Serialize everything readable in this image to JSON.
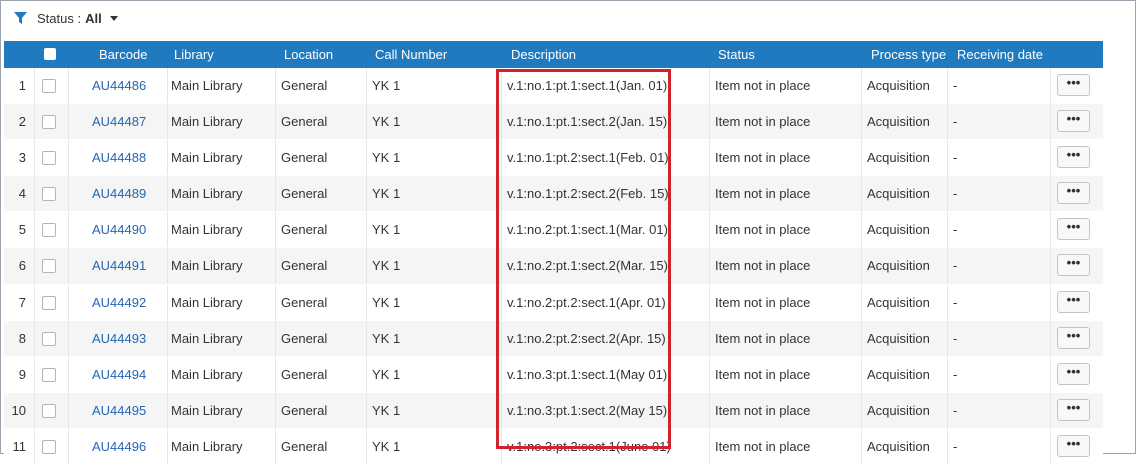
{
  "filter": {
    "status_label": "Status :",
    "status_value": "All"
  },
  "columns": {
    "barcode": "Barcode",
    "library": "Library",
    "location": "Location",
    "call_number": "Call Number",
    "description": "Description",
    "status": "Status",
    "process_type": "Process type",
    "receiving_date": "Receiving date"
  },
  "rows": [
    {
      "n": "1",
      "barcode": "AU44486",
      "library": "Main Library",
      "location": "General",
      "call": "YK 1",
      "description": "v.1:no.1:pt.1:sect.1(Jan. 01)",
      "status": "Item not in place",
      "process": "Acquisition",
      "received": "-",
      "more": "•••"
    },
    {
      "n": "2",
      "barcode": "AU44487",
      "library": "Main Library",
      "location": "General",
      "call": "YK 1",
      "description": "v.1:no.1:pt.1:sect.2(Jan. 15)",
      "status": "Item not in place",
      "process": "Acquisition",
      "received": "-",
      "more": "•••"
    },
    {
      "n": "3",
      "barcode": "AU44488",
      "library": "Main Library",
      "location": "General",
      "call": "YK 1",
      "description": "v.1:no.1:pt.2:sect.1(Feb. 01)",
      "status": "Item not in place",
      "process": "Acquisition",
      "received": "-",
      "more": "•••"
    },
    {
      "n": "4",
      "barcode": "AU44489",
      "library": "Main Library",
      "location": "General",
      "call": "YK 1",
      "description": "v.1:no.1:pt.2:sect.2(Feb. 15)",
      "status": "Item not in place",
      "process": "Acquisition",
      "received": "-",
      "more": "•••"
    },
    {
      "n": "5",
      "barcode": "AU44490",
      "library": "Main Library",
      "location": "General",
      "call": "YK 1",
      "description": "v.1:no.2:pt.1:sect.1(Mar. 01)",
      "status": "Item not in place",
      "process": "Acquisition",
      "received": "-",
      "more": "•••"
    },
    {
      "n": "6",
      "barcode": "AU44491",
      "library": "Main Library",
      "location": "General",
      "call": "YK 1",
      "description": "v.1:no.2:pt.1:sect.2(Mar. 15)",
      "status": "Item not in place",
      "process": "Acquisition",
      "received": "-",
      "more": "•••"
    },
    {
      "n": "7",
      "barcode": "AU44492",
      "library": "Main Library",
      "location": "General",
      "call": "YK 1",
      "description": "v.1:no.2:pt.2:sect.1(Apr. 01)",
      "status": "Item not in place",
      "process": "Acquisition",
      "received": "-",
      "more": "•••"
    },
    {
      "n": "8",
      "barcode": "AU44493",
      "library": "Main Library",
      "location": "General",
      "call": "YK 1",
      "description": "v.1:no.2:pt.2:sect.2(Apr. 15)",
      "status": "Item not in place",
      "process": "Acquisition",
      "received": "-",
      "more": "•••"
    },
    {
      "n": "9",
      "barcode": "AU44494",
      "library": "Main Library",
      "location": "General",
      "call": "YK 1",
      "description": "v.1:no.3:pt.1:sect.1(May 01)",
      "status": "Item not in place",
      "process": "Acquisition",
      "received": "-",
      "more": "•••"
    },
    {
      "n": "10",
      "barcode": "AU44495",
      "library": "Main Library",
      "location": "General",
      "call": "YK 1",
      "description": "v.1:no.3:pt.1:sect.2(May 15)",
      "status": "Item not in place",
      "process": "Acquisition",
      "received": "-",
      "more": "•••"
    },
    {
      "n": "11",
      "barcode": "AU44496",
      "library": "Main Library",
      "location": "General",
      "call": "YK 1",
      "description": "v.1:no.3:pt.2:sect.1(June 01)",
      "status": "Item not in place",
      "process": "Acquisition",
      "received": "-",
      "more": "•••"
    }
  ],
  "icons": {
    "filter": "filter-icon",
    "dropdown": "caret-down-icon"
  },
  "colors": {
    "header_bg": "#1f7ac0",
    "link": "#2466b4",
    "highlight": "#d0232b"
  }
}
